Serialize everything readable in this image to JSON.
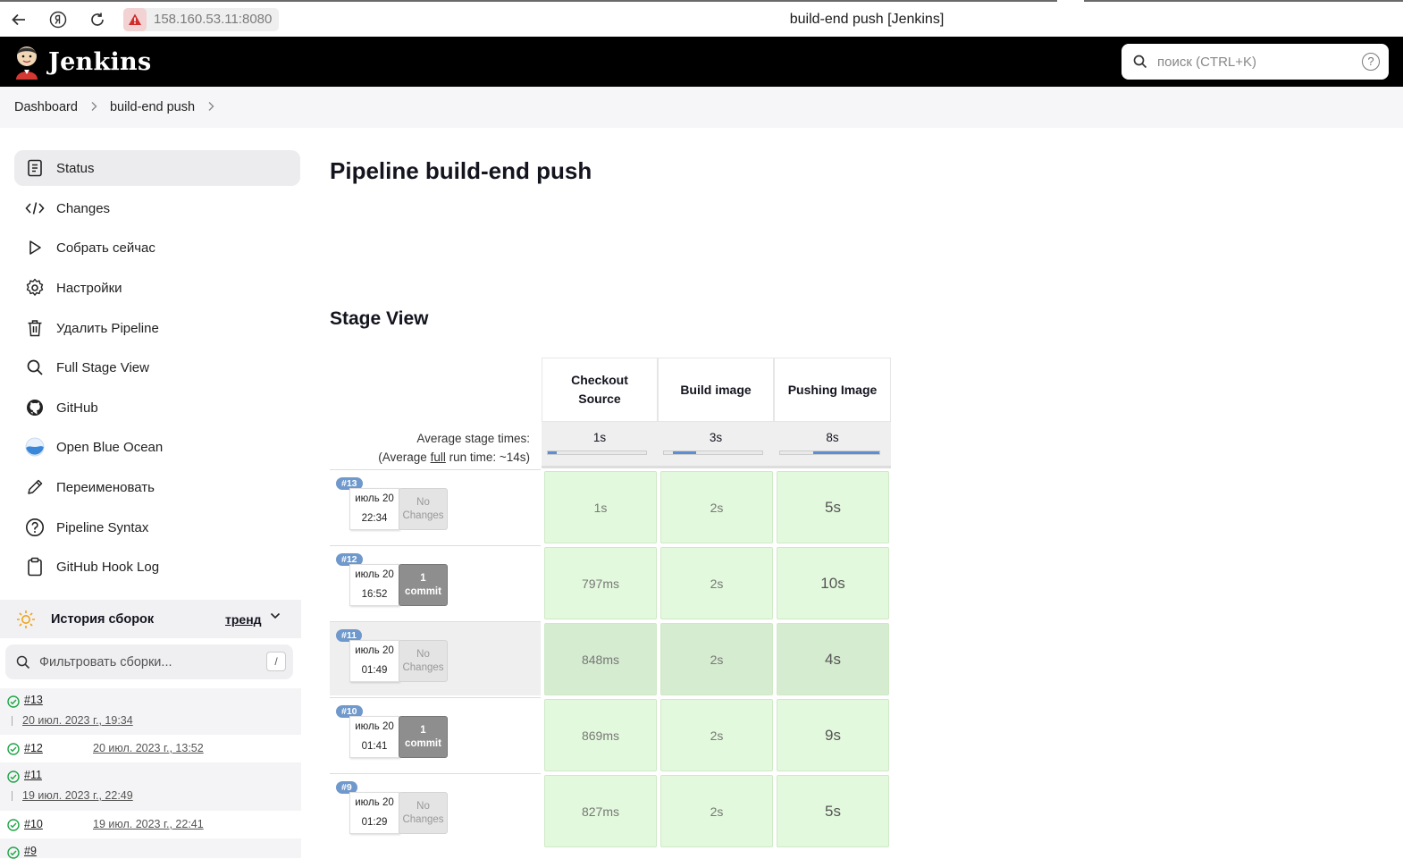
{
  "browser": {
    "url": "158.160.53.11:8080",
    "tab_title": "build-end push [Jenkins]"
  },
  "header": {
    "logo_text": "Jenkins",
    "search_placeholder": "поиск (CTRL+K)",
    "help": "?"
  },
  "breadcrumb": [
    "Dashboard",
    "build-end push"
  ],
  "sidebar": {
    "items": [
      {
        "label": "Status",
        "icon": "document-icon"
      },
      {
        "label": "Changes",
        "icon": "code-icon"
      },
      {
        "label": "Собрать сейчас",
        "icon": "play-icon"
      },
      {
        "label": "Настройки",
        "icon": "gear-icon"
      },
      {
        "label": "Удалить Pipeline",
        "icon": "trash-icon"
      },
      {
        "label": "Full Stage View",
        "icon": "search-icon"
      },
      {
        "label": "GitHub",
        "icon": "github-icon"
      },
      {
        "label": "Open Blue Ocean",
        "icon": "blue-ocean-icon"
      },
      {
        "label": "Переименовать",
        "icon": "pencil-icon"
      },
      {
        "label": "Pipeline Syntax",
        "icon": "help-circle-icon"
      },
      {
        "label": "GitHub Hook Log",
        "icon": "clipboard-icon"
      }
    ]
  },
  "history": {
    "title": "История сборок",
    "trend": "тренд",
    "filter_placeholder": "Фильтровать сборки...",
    "filter_shortcut": "/",
    "builds": [
      {
        "num": "#13",
        "date": "20 июл. 2023 г., 19:34"
      },
      {
        "num": "#12",
        "date": "20 июл. 2023 г., 13:52"
      },
      {
        "num": "#11",
        "date": "19 июл. 2023 г., 22:49"
      },
      {
        "num": "#10",
        "date": "19 июл. 2023 г., 22:41"
      },
      {
        "num": "#9",
        "date": ""
      }
    ]
  },
  "main": {
    "title": "Pipeline build-end push",
    "stage_view_title": "Stage View",
    "avg_label_1": "Average stage times:",
    "avg_label_2a": "(Average ",
    "avg_label_2b": "full",
    "avg_label_2c": " run time: ~14s)",
    "stages": [
      {
        "name_line1": "Checkout",
        "name_line2": "Source",
        "avg": "1s",
        "bar_from": 0.0,
        "bar_to": 0.09
      },
      {
        "name_line1": "Build image",
        "name_line2": "",
        "avg": "3s",
        "bar_from": 0.09,
        "bar_to": 0.33
      },
      {
        "name_line1": "Pushing Image",
        "name_line2": "",
        "avg": "8s",
        "bar_from": 0.33,
        "bar_to": 1.0
      }
    ],
    "runs": [
      {
        "badge": "#13",
        "date": "июль 20",
        "time": "22:34",
        "changes_1": "No",
        "changes_2": "Changes",
        "changes_type": "none",
        "times": [
          "1s",
          "2s",
          "5s"
        ]
      },
      {
        "badge": "#12",
        "date": "июль 20",
        "time": "16:52",
        "changes_1": "1",
        "changes_2": "commit",
        "changes_type": "commit",
        "times": [
          "797ms",
          "2s",
          "10s"
        ]
      },
      {
        "badge": "#11",
        "date": "июль 20",
        "time": "01:49",
        "changes_1": "No",
        "changes_2": "Changes",
        "changes_type": "none",
        "times": [
          "848ms",
          "2s",
          "4s"
        ]
      },
      {
        "badge": "#10",
        "date": "июль 20",
        "time": "01:41",
        "changes_1": "1",
        "changes_2": "commit",
        "changes_type": "commit",
        "times": [
          "869ms",
          "2s",
          "9s"
        ]
      },
      {
        "badge": "#9",
        "date": "июль 20",
        "time": "01:29",
        "changes_1": "No",
        "changes_2": "Changes",
        "changes_type": "none",
        "times": [
          "827ms",
          "2s",
          "5s"
        ]
      }
    ]
  },
  "colors": {
    "header_bg": "#000000",
    "success_cell": "#e3f9dd",
    "badge": "#6f99cc",
    "ok_icon": "#1ea446"
  }
}
